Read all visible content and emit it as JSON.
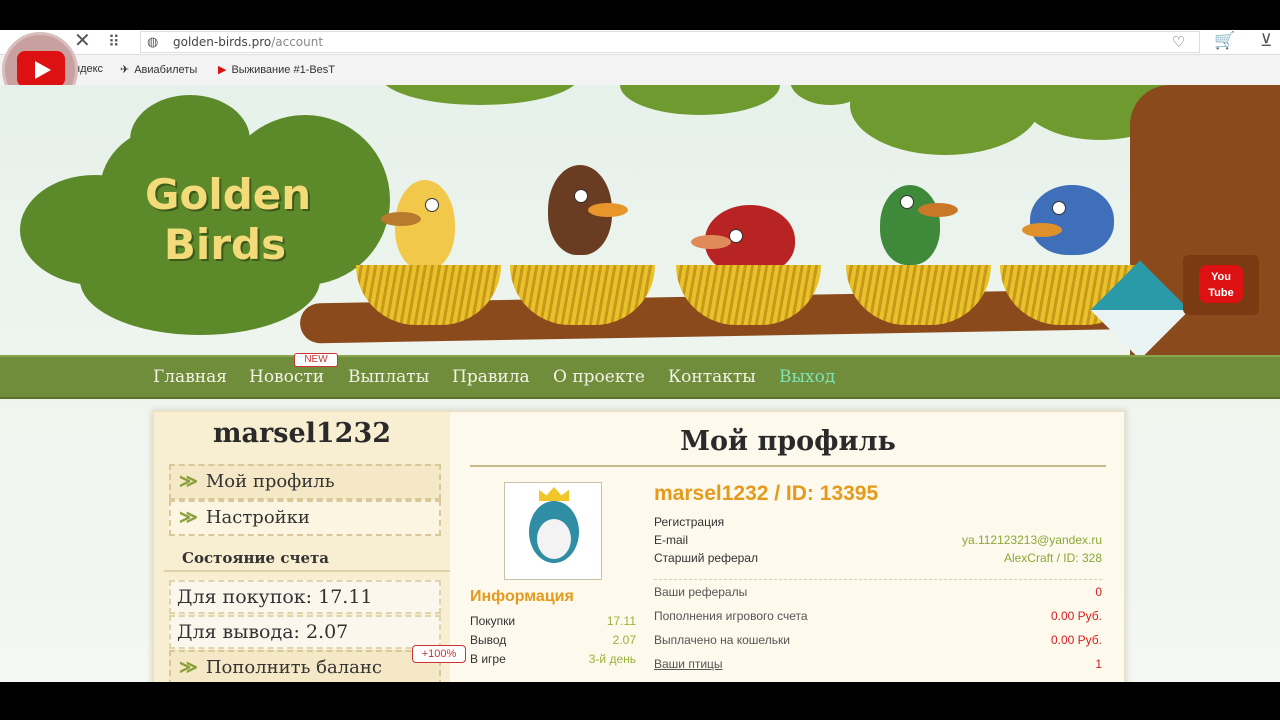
{
  "browser": {
    "url_host": "golden-birds.pro",
    "url_path": "/account",
    "bookmarks": [
      {
        "label": "ндекс",
        "icon": ""
      },
      {
        "label": "Авиабилеты",
        "icon": "airplane-icon"
      },
      {
        "label": "Выживание #1-BesT",
        "icon": "youtube-icon"
      }
    ]
  },
  "site": {
    "logo_line1": "Golden",
    "logo_line2": "Birds",
    "youtube_label_1": "You",
    "youtube_label_2": "Tube",
    "menu": [
      {
        "label": "Главная"
      },
      {
        "label": "Новости"
      },
      {
        "label": "Выплаты"
      },
      {
        "label": "Правила"
      },
      {
        "label": "О проекте"
      },
      {
        "label": "Контакты"
      },
      {
        "label": "Выход"
      }
    ],
    "new_badge": "NEW"
  },
  "sidebar": {
    "username": "marsel1232",
    "items": [
      {
        "label": "Мой профиль"
      },
      {
        "label": "Настройки"
      }
    ],
    "account_title": "Состояние счета",
    "purchases": "Для покупок: 17.11",
    "withdraw": "Для вывода: 2.07",
    "topup": "Пополнить баланс",
    "bonus": "+100%"
  },
  "profile": {
    "title": "Мой профиль",
    "name_id": "marsel1232 / ID: 13395",
    "registration_label": "Регистрация",
    "email_label": "E-mail",
    "email_value": "ya.112123213@yandex.ru",
    "referrer_label": "Старший реферал",
    "referrer_value": "AlexCraft / ID: 328",
    "referrals_label": "Ваши рефералы",
    "referrals_value": "0",
    "deposits_label": "Пополнения игрового счета",
    "deposits_value": "0.00 Руб.",
    "paid_label": "Выплачено на кошельки",
    "paid_value": "0.00 Руб.",
    "birds_label": "Ваши птицы",
    "birds_value": "1"
  },
  "info": {
    "title": "Информация",
    "rows": [
      {
        "label": "Покупки",
        "value": "17.11"
      },
      {
        "label": "Вывод",
        "value": "2.07"
      },
      {
        "label": "В игре",
        "value": "3-й день"
      }
    ]
  },
  "colors": {
    "menu_bg": "#6f8d3b",
    "accent_orange": "#e49a1c",
    "accent_green": "#8aa83a",
    "value_red": "#d42020",
    "exit_color": "#7fe3b5"
  }
}
